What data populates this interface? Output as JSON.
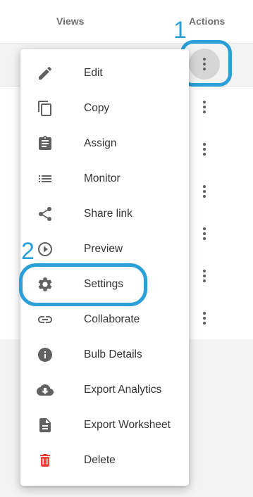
{
  "table": {
    "headers": {
      "views": "Views",
      "actions": "Actions"
    }
  },
  "annotations": {
    "first": "1",
    "second": "2"
  },
  "menu": {
    "items": [
      {
        "label": "Edit",
        "icon": "pencil-icon"
      },
      {
        "label": "Copy",
        "icon": "copy-icon"
      },
      {
        "label": "Assign",
        "icon": "clipboard-icon"
      },
      {
        "label": "Monitor",
        "icon": "list-icon"
      },
      {
        "label": "Share link",
        "icon": "share-icon"
      },
      {
        "label": "Preview",
        "icon": "play-circle-icon"
      },
      {
        "label": "Settings",
        "icon": "gear-icon"
      },
      {
        "label": "Collaborate",
        "icon": "link-icon"
      },
      {
        "label": "Bulb Details",
        "icon": "info-icon"
      },
      {
        "label": "Export Analytics",
        "icon": "cloud-download-icon"
      },
      {
        "label": "Export Worksheet",
        "icon": "document-icon"
      },
      {
        "label": "Delete",
        "icon": "trash-icon"
      }
    ]
  },
  "colors": {
    "icon": "#616161",
    "delete_icon": "#f44336",
    "annotation": "#2a9fd8",
    "text": "#333333"
  }
}
